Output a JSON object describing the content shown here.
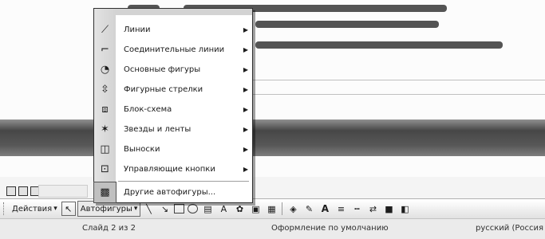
{
  "autoshapes_menu": {
    "items": [
      {
        "label": "Линии",
        "icon": "lines-icon",
        "submenu": true
      },
      {
        "label": "Соединительные линии",
        "icon": "connectors-icon",
        "submenu": true
      },
      {
        "label": "Основные фигуры",
        "icon": "basic-shapes-icon",
        "submenu": true
      },
      {
        "label": "Фигурные стрелки",
        "icon": "block-arrows-icon",
        "submenu": true
      },
      {
        "label": "Блок-схема",
        "icon": "flowchart-icon",
        "submenu": true
      },
      {
        "label": "Звезды и ленты",
        "icon": "stars-banners-icon",
        "submenu": true
      },
      {
        "label": "Выноски",
        "icon": "callouts-icon",
        "submenu": true
      },
      {
        "label": "Управляющие кнопки",
        "icon": "action-buttons-icon",
        "submenu": true
      }
    ],
    "more_label": "Другие автофигуры...",
    "submenu_arrow": "▶"
  },
  "toolbar": {
    "actions_label": "Действия",
    "autoshapes_label": "Автофигуры",
    "dropdown_glyph": "▾"
  },
  "statusbar": {
    "slide": "Слайд 2 из 2",
    "design": "Оформление по умолчанию",
    "language": "русский (Россия"
  }
}
